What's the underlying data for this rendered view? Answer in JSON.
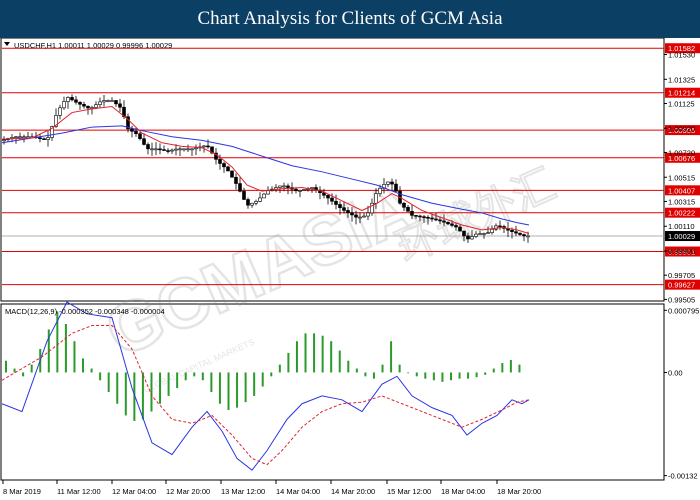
{
  "banner": {
    "title": "Chart Analysis for Clients of GCM Asia"
  },
  "watermark": {
    "text": "GCMASIA",
    "cn": "环球外汇",
    "sub": "GLOBAL CAPITAL MARKETS"
  },
  "chart_data": [
    {
      "type": "candlestick",
      "title": "USDCHF,H1  1.00011 1.00029 0.99996 1.00029",
      "ylim": [
        0.995,
        1.0165
      ],
      "y_tick_labels": [
        "1.01530",
        "1.01325",
        "1.01125",
        "1.00920",
        "1.00720",
        "1.00515",
        "1.00315",
        "1.00110",
        "0.99905",
        "0.99705",
        "0.99505"
      ],
      "y_ticks": [
        1.0153,
        1.01325,
        1.01125,
        1.0092,
        1.0072,
        1.00515,
        1.00315,
        1.0011,
        0.99905,
        0.99705,
        0.99505
      ],
      "x_tick_labels": [
        "8 Mar 2019",
        "11 Mar 12:00",
        "12 Mar 04:00",
        "12 Mar 20:00",
        "13 Mar 12:00",
        "14 Mar 04:00",
        "14 Mar 20:00",
        "15 Mar 12:00",
        "18 Mar 04:00",
        "18 Mar 20:00"
      ],
      "levels": [
        {
          "label": "1.01582",
          "value": 1.01582
        },
        {
          "label": "1.01214",
          "value": 1.01214
        },
        {
          "label": "1.00905",
          "value": 1.00905
        },
        {
          "label": "1.00676",
          "value": 1.00676
        },
        {
          "label": "1.00407",
          "value": 1.00407
        },
        {
          "label": "1.00222",
          "value": 1.00222
        },
        {
          "label": "0.99901",
          "value": 0.99901
        },
        {
          "label": "0.99627",
          "value": 0.99627
        }
      ],
      "current_price": {
        "label": "1.00029",
        "value": 1.00029
      },
      "price_path": [
        [
          0,
          1.0082
        ],
        [
          12,
          1.0085
        ],
        [
          30,
          1.0085
        ],
        [
          45,
          1.0082
        ],
        [
          55,
          1.0105
        ],
        [
          65,
          1.0118
        ],
        [
          75,
          1.0113
        ],
        [
          88,
          1.0108
        ],
        [
          100,
          1.0115
        ],
        [
          110,
          1.0115
        ],
        [
          120,
          1.0108
        ],
        [
          125,
          1.0092
        ],
        [
          135,
          1.0087
        ],
        [
          145,
          1.0075
        ],
        [
          155,
          1.0075
        ],
        [
          165,
          1.0073
        ],
        [
          175,
          1.0075
        ],
        [
          190,
          1.0075
        ],
        [
          205,
          1.0078
        ],
        [
          215,
          1.0065
        ],
        [
          225,
          1.0058
        ],
        [
          235,
          1.0045
        ],
        [
          245,
          1.0028
        ],
        [
          255,
          1.0032
        ],
        [
          265,
          1.004
        ],
        [
          280,
          1.0045
        ],
        [
          295,
          1.004
        ],
        [
          310,
          1.0043
        ],
        [
          325,
          1.0035
        ],
        [
          340,
          1.0025
        ],
        [
          355,
          1.0018
        ],
        [
          365,
          1.002
        ],
        [
          375,
          1.004
        ],
        [
          385,
          1.0048
        ],
        [
          392,
          1.0045
        ],
        [
          398,
          1.003
        ],
        [
          410,
          1.002
        ],
        [
          425,
          1.0018
        ],
        [
          440,
          1.0015
        ],
        [
          455,
          1.001
        ],
        [
          465,
          1.0
        ],
        [
          475,
          1.0005
        ],
        [
          485,
          1.0005
        ],
        [
          495,
          1.0012
        ],
        [
          505,
          1.0008
        ],
        [
          515,
          1.0005
        ],
        [
          522,
          1.0003
        ],
        [
          527,
          1.0003
        ]
      ],
      "ma_fast": [
        [
          0,
          1.0083
        ],
        [
          30,
          1.0084
        ],
        [
          50,
          1.0092
        ],
        [
          70,
          1.0105
        ],
        [
          90,
          1.0108
        ],
        [
          110,
          1.011
        ],
        [
          125,
          1.01
        ],
        [
          140,
          1.0088
        ],
        [
          160,
          1.008
        ],
        [
          180,
          1.0077
        ],
        [
          200,
          1.0076
        ],
        [
          215,
          1.007
        ],
        [
          230,
          1.006
        ],
        [
          245,
          1.0045
        ],
        [
          260,
          1.004
        ],
        [
          280,
          1.0042
        ],
        [
          300,
          1.0043
        ],
        [
          320,
          1.004
        ],
        [
          340,
          1.0032
        ],
        [
          360,
          1.0024
        ],
        [
          375,
          1.003
        ],
        [
          390,
          1.0038
        ],
        [
          400,
          1.0034
        ],
        [
          420,
          1.0024
        ],
        [
          440,
          1.0018
        ],
        [
          460,
          1.0012
        ],
        [
          480,
          1.0008
        ],
        [
          500,
          1.001
        ],
        [
          515,
          1.0008
        ],
        [
          527,
          1.0005
        ]
      ],
      "ma_slow": [
        [
          0,
          1.008
        ],
        [
          30,
          1.0084
        ],
        [
          60,
          1.0088
        ],
        [
          90,
          1.0093
        ],
        [
          120,
          1.0094
        ],
        [
          140,
          1.009
        ],
        [
          170,
          1.0085
        ],
        [
          200,
          1.0082
        ],
        [
          230,
          1.0077
        ],
        [
          260,
          1.0069
        ],
        [
          290,
          1.0061
        ],
        [
          320,
          1.0056
        ],
        [
          350,
          1.005
        ],
        [
          375,
          1.0045
        ],
        [
          400,
          1.0037
        ],
        [
          430,
          1.003
        ],
        [
          460,
          1.0025
        ],
        [
          480,
          1.0022
        ],
        [
          500,
          1.0017
        ],
        [
          515,
          1.0014
        ],
        [
          527,
          1.0012
        ]
      ],
      "colors": {
        "ma_fast": "#e0242e",
        "ma_slow": "#2b36e0",
        "level_line": "#e00000",
        "candle": "#000000"
      }
    },
    {
      "type": "line",
      "title": "MACD(12,26,9) -0.000352 -0.000348 -0.000004",
      "ylim": [
        -0.00135,
        0.00085
      ],
      "y_tick_labels": [
        "0.000795",
        "0.00",
        "-0.00132"
      ],
      "y_ticks": [
        0.000795,
        0.0,
        -0.00132
      ],
      "histogram": [
        0.00015,
        5e-05,
        -5e-05,
        0.0001,
        0.0003,
        0.00055,
        0.00078,
        0.00062,
        0.0004,
        0.00018,
        5e-05,
        -0.0001,
        -0.00025,
        -0.0004,
        -0.00055,
        -0.00062,
        -0.0006,
        -0.0005,
        -0.0004,
        -0.0003,
        -0.0002,
        -0.0001,
        -5e-05,
        -0.0001,
        -0.00025,
        -0.0004,
        -0.00048,
        -0.00045,
        -0.00038,
        -0.0003,
        -0.00018,
        -5e-05,
        0.0001,
        0.00025,
        0.0004,
        0.0005,
        0.0005,
        0.00047,
        0.0004,
        0.00028,
        0.00015,
        5e-05,
        -5e-05,
        -8e-05,
        0.0001,
        0.0004,
        0.0001,
        0.0,
        -5e-05,
        -8e-05,
        -0.0001,
        -0.00012,
        -0.0001,
        -8e-05,
        -8e-05,
        -6e-05,
        -3e-05,
        5e-05,
        0.00012,
        0.00016,
        0.0001
      ],
      "signal": [
        [
          0,
          -0.0001
        ],
        [
          40,
          0.0002
        ],
        [
          70,
          0.0005
        ],
        [
          90,
          0.0006
        ],
        [
          110,
          0.0006
        ],
        [
          130,
          0.0003
        ],
        [
          150,
          -0.0003
        ],
        [
          170,
          -0.0006
        ],
        [
          190,
          -0.00065
        ],
        [
          210,
          -0.00055
        ],
        [
          230,
          -0.0008
        ],
        [
          250,
          -0.0011
        ],
        [
          265,
          -0.00118
        ],
        [
          280,
          -0.001
        ],
        [
          300,
          -0.0007
        ],
        [
          320,
          -0.0005
        ],
        [
          340,
          -0.0004
        ],
        [
          360,
          -0.00038
        ],
        [
          380,
          -0.0003
        ],
        [
          400,
          -0.0004
        ],
        [
          430,
          -0.00055
        ],
        [
          460,
          -0.0007
        ],
        [
          480,
          -0.0006
        ],
        [
          500,
          -0.00048
        ],
        [
          515,
          -0.00038
        ],
        [
          527,
          -0.00035
        ]
      ],
      "macd_line": [
        [
          0,
          -0.0004
        ],
        [
          20,
          -0.0005
        ],
        [
          45,
          0.0004
        ],
        [
          65,
          0.0009
        ],
        [
          85,
          0.00075
        ],
        [
          110,
          0.0007
        ],
        [
          130,
          -0.0002
        ],
        [
          150,
          -0.0009
        ],
        [
          170,
          -0.00105
        ],
        [
          190,
          -0.0007
        ],
        [
          205,
          -0.0005
        ],
        [
          220,
          -0.00075
        ],
        [
          235,
          -0.0011
        ],
        [
          250,
          -0.00125
        ],
        [
          265,
          -0.001
        ],
        [
          285,
          -0.0006
        ],
        [
          300,
          -0.0004
        ],
        [
          320,
          -0.0003
        ],
        [
          340,
          -0.00035
        ],
        [
          360,
          -0.0005
        ],
        [
          380,
          -0.00015
        ],
        [
          395,
          -5e-05
        ],
        [
          410,
          -0.0003
        ],
        [
          430,
          -0.00045
        ],
        [
          450,
          -0.00055
        ],
        [
          465,
          -0.0008
        ],
        [
          480,
          -0.00065
        ],
        [
          495,
          -0.00055
        ],
        [
          510,
          -0.00035
        ],
        [
          520,
          -0.0004
        ],
        [
          527,
          -0.00035
        ]
      ],
      "colors": {
        "histogram": "#2a9b2a",
        "macd_line": "#2b36e0",
        "signal": "#e0242e"
      }
    }
  ]
}
